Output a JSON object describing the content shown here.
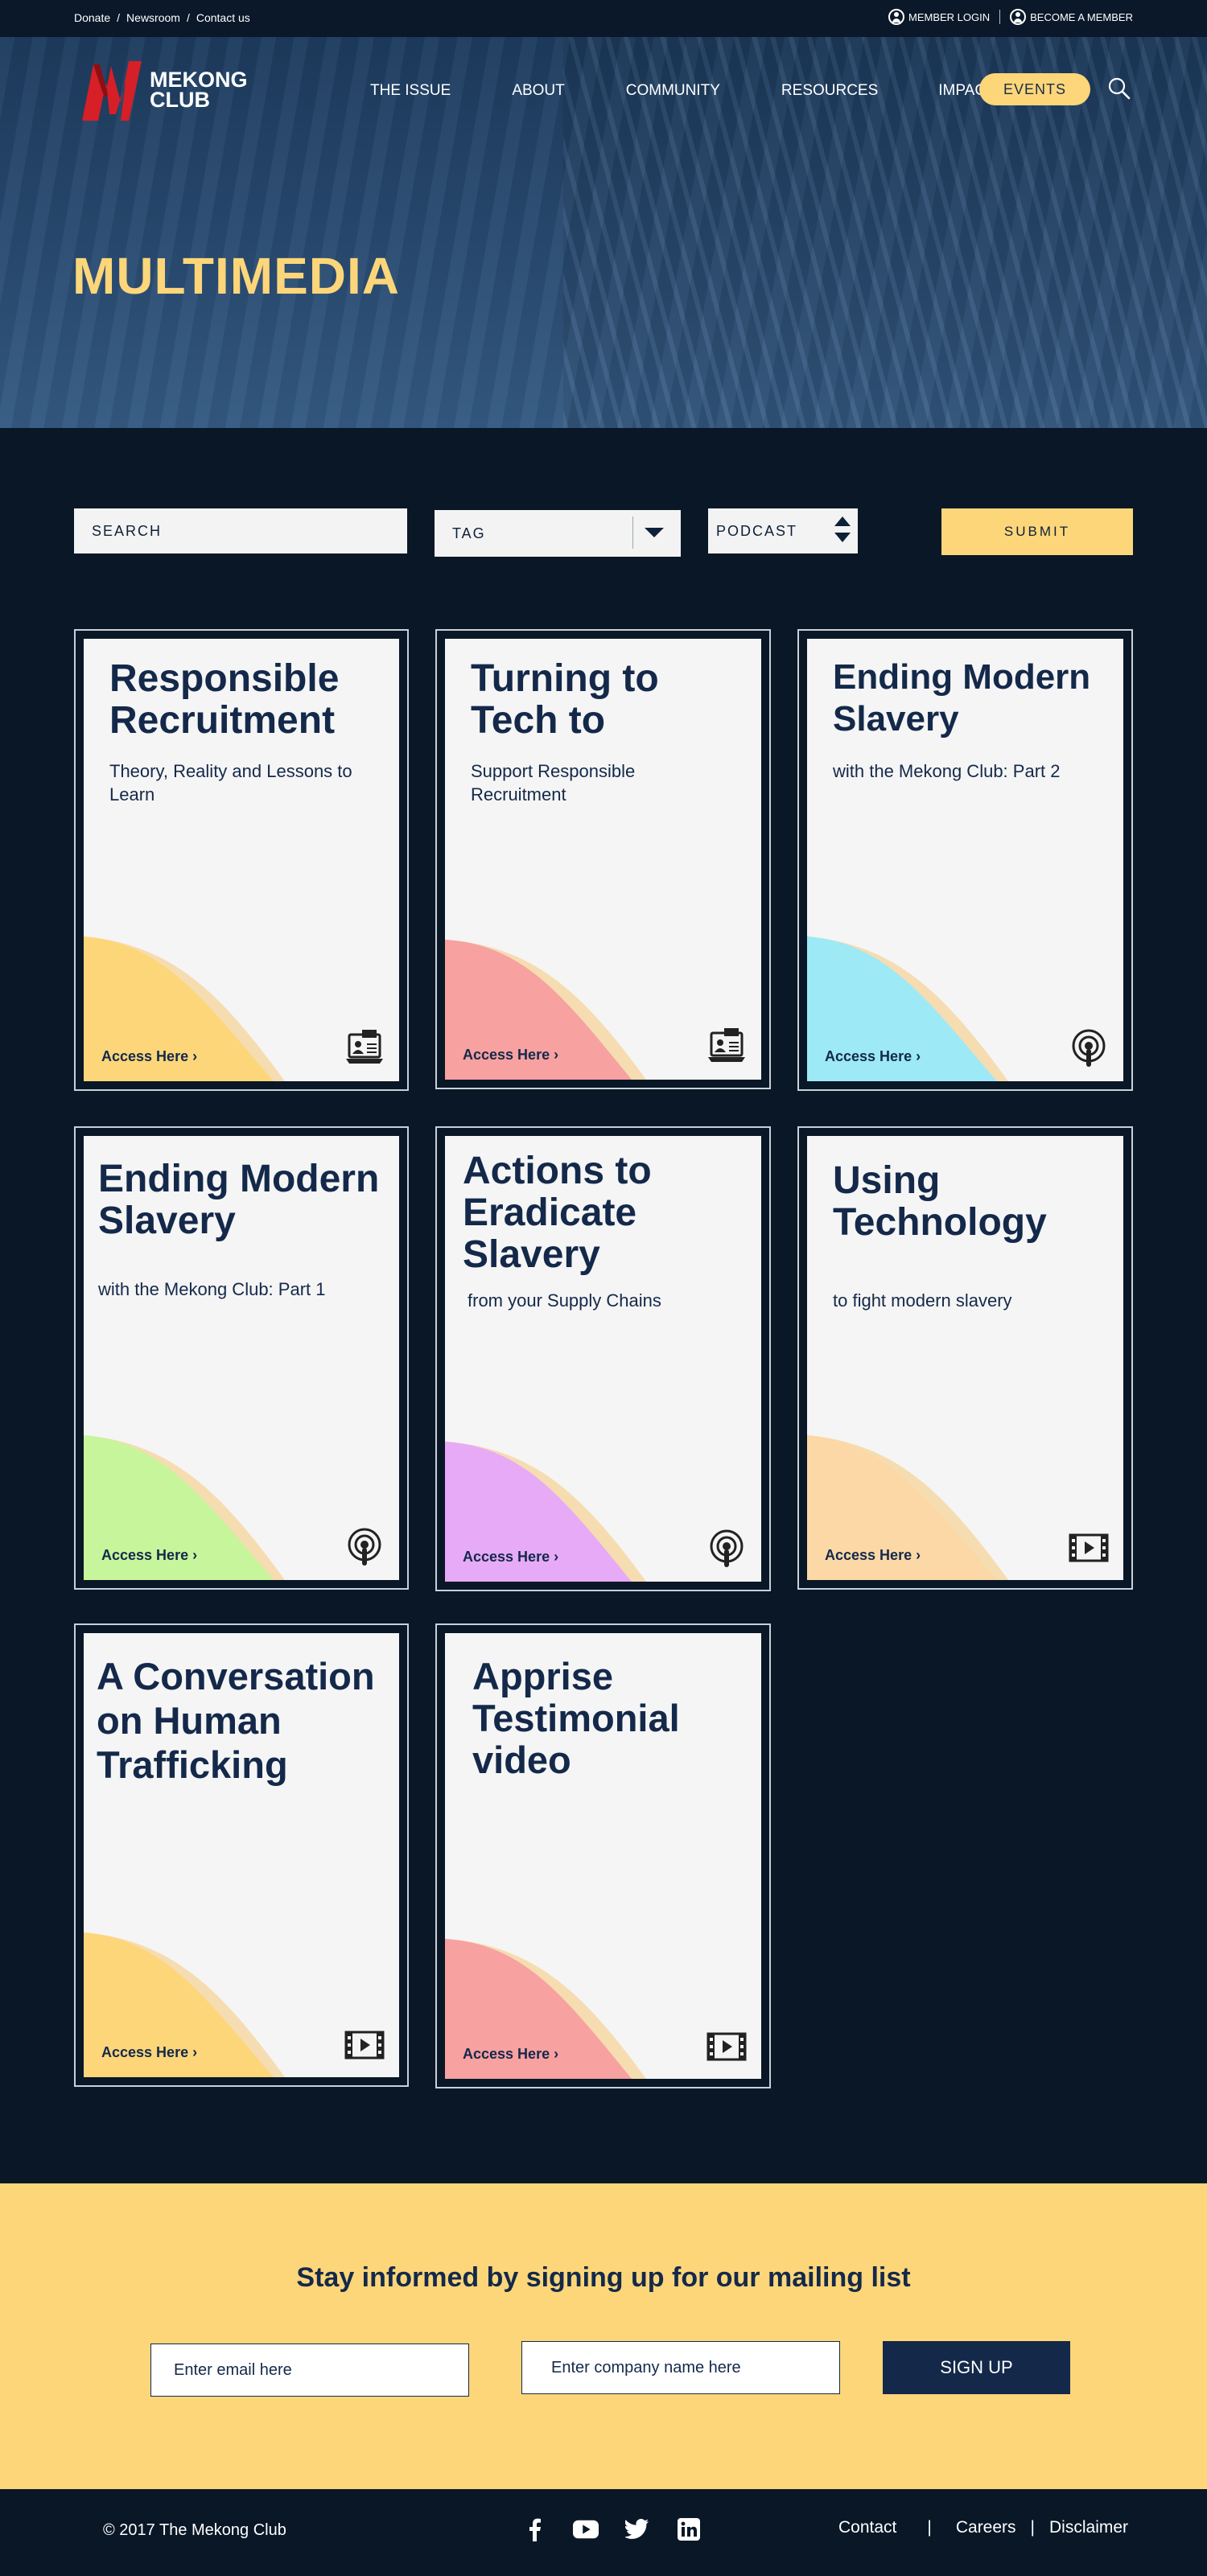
{
  "topbar": {
    "links": [
      "Donate",
      "Newsroom",
      "Contact us"
    ],
    "member_login": "MEMBER LOGIN",
    "become_member": "BECOME A MEMBER"
  },
  "header": {
    "logo_line1": "MEKONG",
    "logo_line2": "CLUB",
    "nav": [
      "THE ISSUE",
      "ABOUT",
      "COMMUNITY",
      "RESOURCES",
      "IMPACT"
    ],
    "events": "EVENTS"
  },
  "hero": {
    "title": "MULTIMEDIA"
  },
  "filters": {
    "search_placeholder": "SEARCH",
    "tag": "TAG",
    "type": "PODCAST",
    "submit": "SUBMIT"
  },
  "cards": [
    {
      "title": "Responsible Recruitment",
      "subtitle": "Theory, Reality and Lessons to Learn",
      "cta": "Access Here",
      "color": "#fdd67a",
      "icon": "webinar-icon"
    },
    {
      "title": "Turning to Tech to",
      "subtitle": "Support Responsible Recruitment",
      "cta": "Access Here",
      "color": "#f7a1a0",
      "icon": "webinar-icon"
    },
    {
      "title": "Ending Modern Slavery",
      "subtitle": "with the Mekong Club: Part 2",
      "cta": "Access Here",
      "color": "#9de9f6",
      "icon": "podcast-icon"
    },
    {
      "title": "Ending Modern Slavery",
      "subtitle": "with the Mekong Club: Part 1",
      "cta": "Access Here",
      "color": "#c7f59c",
      "icon": "podcast-icon"
    },
    {
      "title": "Actions to Eradicate Slavery",
      "subtitle": "from  your Supply Chains",
      "cta": "Access Here",
      "color": "#e7aaf6",
      "icon": "podcast-icon"
    },
    {
      "title": "Using Technology",
      "subtitle": "to fight modern slavery",
      "cta": "Access Here",
      "color": "#fbd8a6",
      "icon": "video-icon"
    },
    {
      "title": "A Conversation on Human Trafficking",
      "subtitle": "",
      "cta": "Access Here",
      "color": "#fdd67a",
      "icon": "video-icon"
    },
    {
      "title": "Apprise Testimonial video",
      "subtitle": "",
      "cta": "Access Here",
      "color": "#f7a1a0",
      "icon": "video-icon"
    }
  ],
  "mailing": {
    "heading": "Stay informed by signing up for our mailing list",
    "email_placeholder": "Enter email here",
    "company_placeholder": "Enter  company name here",
    "signup": "SIGN UP"
  },
  "footer": {
    "copyright": "© 2017 The Mekong Club",
    "links": [
      "Contact",
      "Careers",
      "Disclaimer"
    ]
  }
}
